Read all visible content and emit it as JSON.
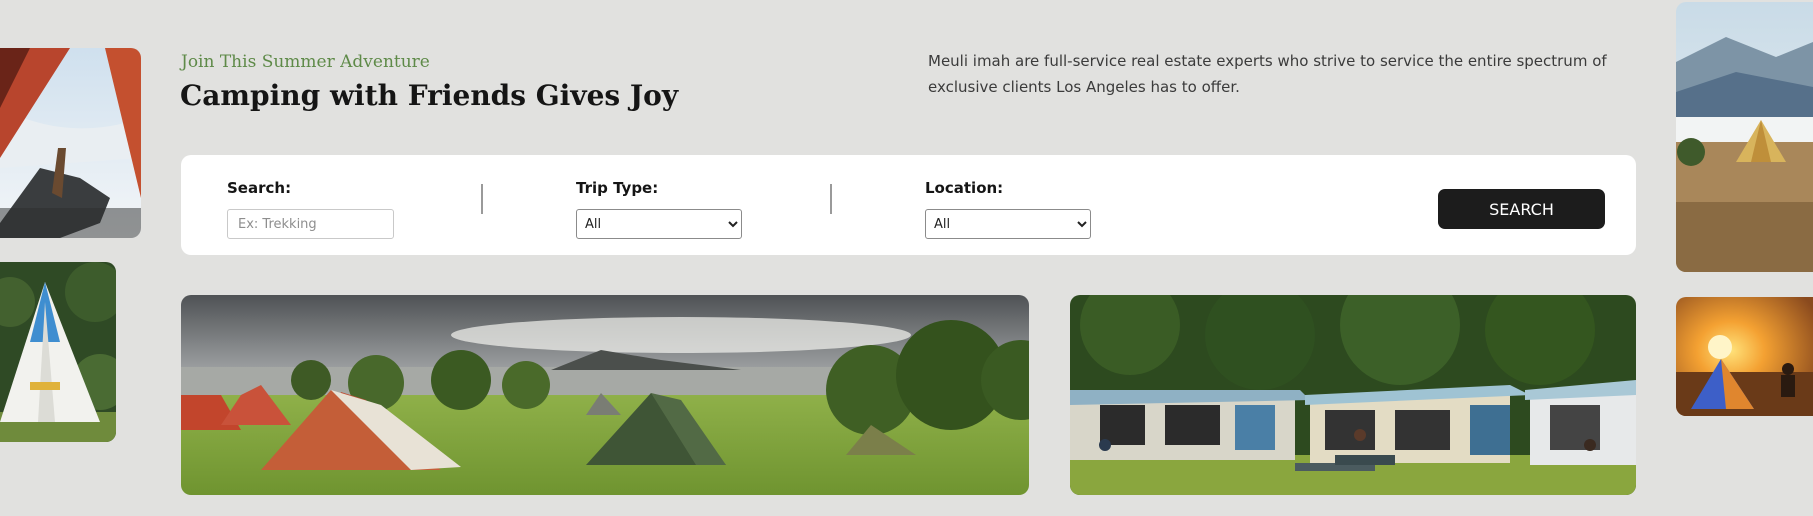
{
  "hero": {
    "kicker": "Join This Summer Adventure",
    "title": "Camping with Friends Gives Joy",
    "description": "Meuli imah are full-service real estate experts who strive to service the entire spectrum of exclusive clients Los Angeles has to offer."
  },
  "search_form": {
    "search_label": "Search:",
    "search_placeholder": "Ex: Trekking",
    "trip_type_label": "Trip Type:",
    "trip_type_value": "All",
    "location_label": "Location:",
    "location_value": "All",
    "button_label": "SEARCH"
  },
  "colors": {
    "page_background": "#e1e1df",
    "kicker_green": "#5e8a48",
    "button_dark": "#1c1c1c"
  }
}
